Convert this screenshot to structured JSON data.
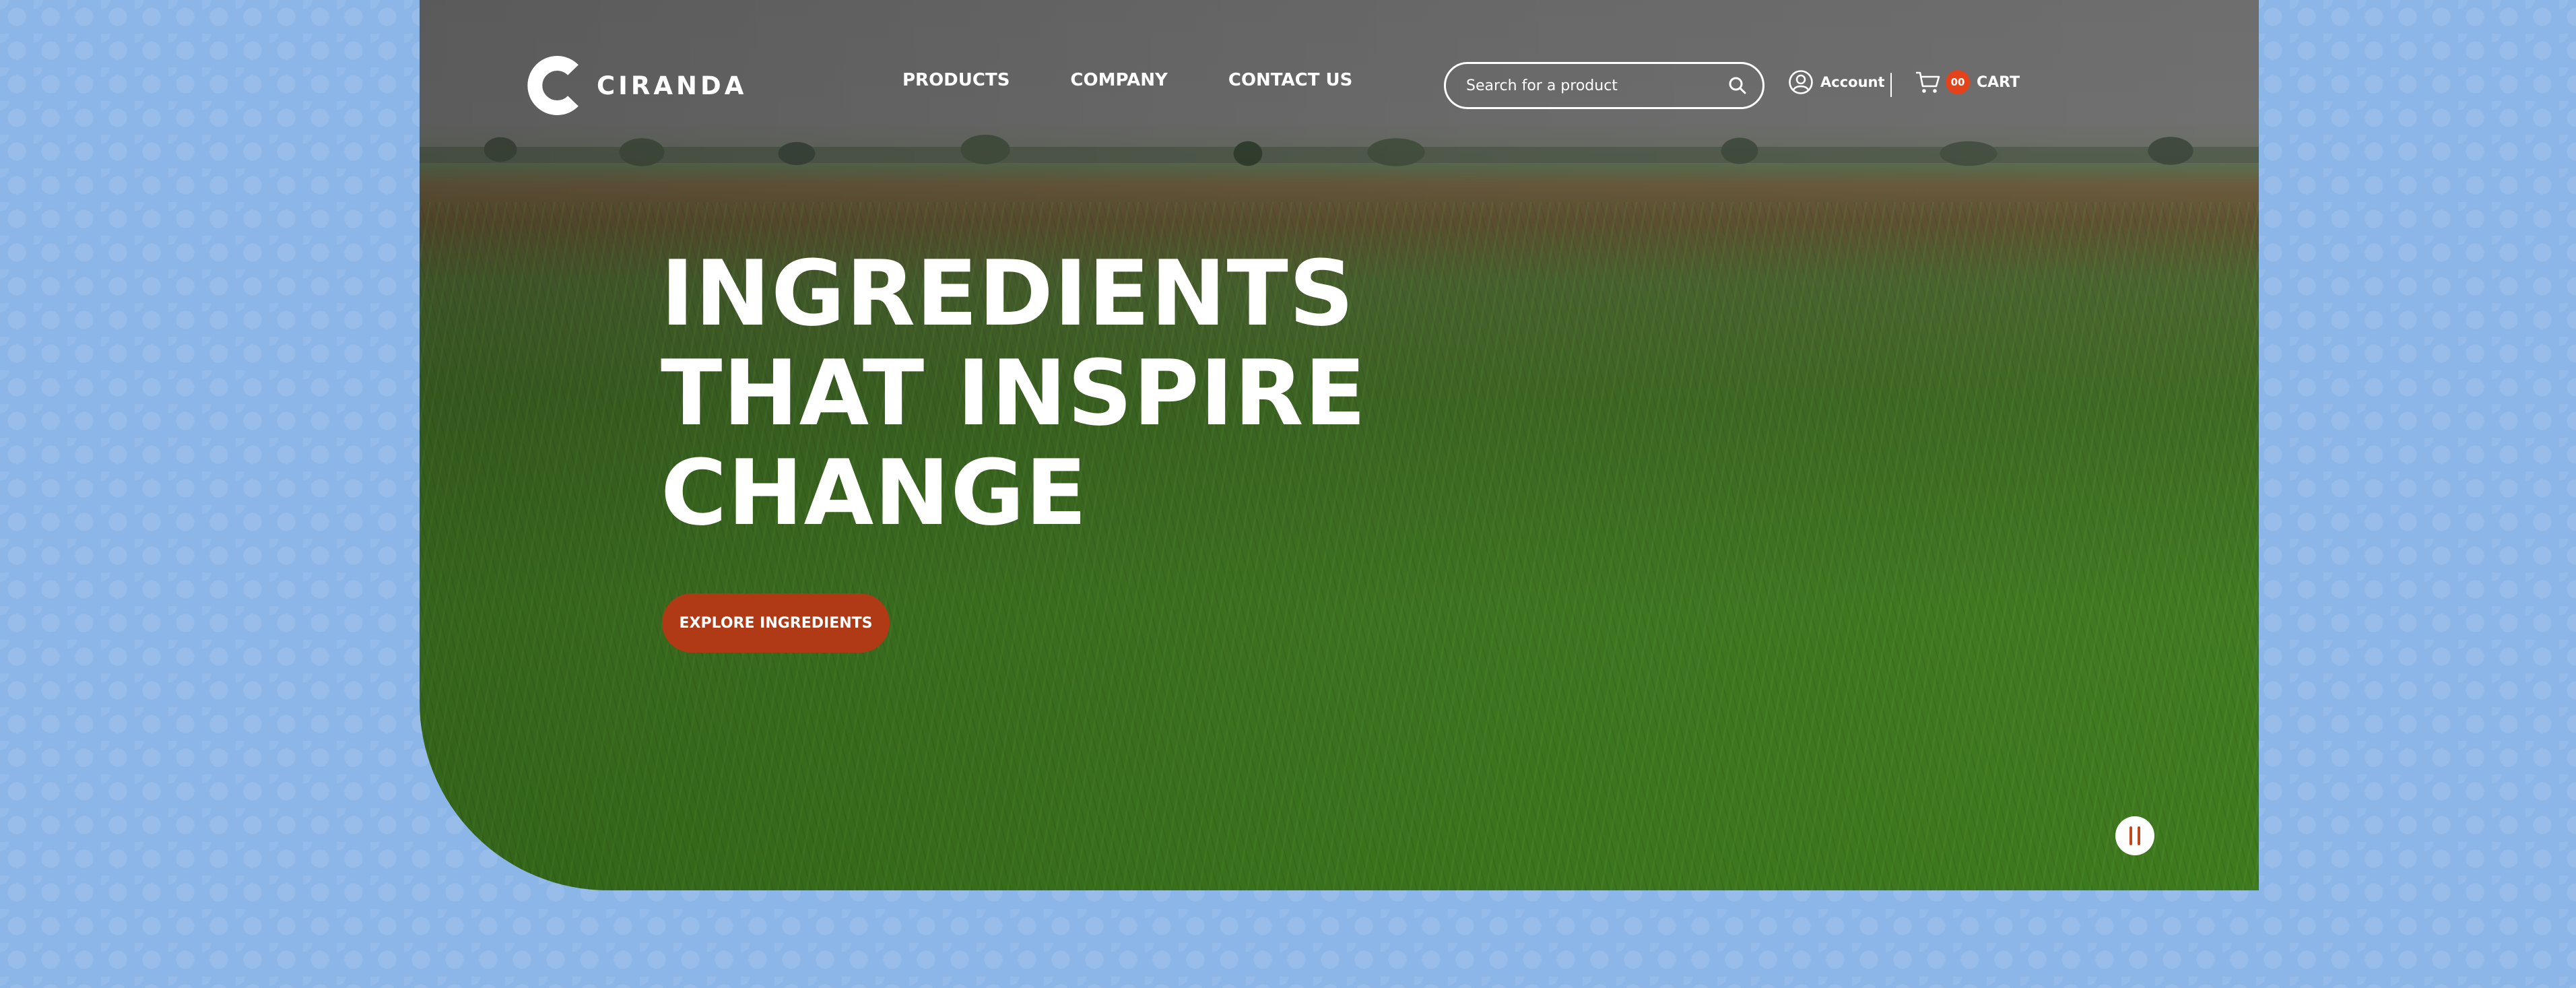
{
  "brand": {
    "name": "CIRANDA"
  },
  "nav": {
    "items": [
      {
        "label": "PRODUCTS"
      },
      {
        "label": "COMPANY"
      },
      {
        "label": "CONTACT US"
      }
    ]
  },
  "search": {
    "placeholder": "Search for a product",
    "value": "",
    "icon": "search-icon"
  },
  "account": {
    "label": "Account",
    "icon": "user-circle-icon"
  },
  "cart": {
    "label": "CART",
    "count": "00",
    "icon": "cart-icon"
  },
  "hero": {
    "headline_lines": [
      "INGREDIENTS",
      "THAT INSPIRE",
      "CHANGE"
    ],
    "cta_label": "EXPLORE INGREDIENTS",
    "video_control": "pause-icon"
  },
  "colors": {
    "page_background": "#8db6e8",
    "accent": "#b03a16",
    "cart_badge": "#e3421b",
    "text": "#ffffff"
  }
}
